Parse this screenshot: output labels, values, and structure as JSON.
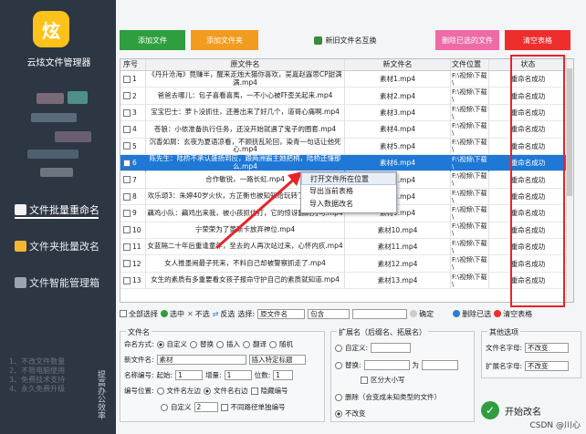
{
  "sidebar": {
    "app_name": "云炫文件管理器",
    "logo_text": "炫",
    "nav": [
      {
        "label": "文件批量重命名"
      },
      {
        "label": "文件夹批量改名"
      },
      {
        "label": "文件智能管理箱"
      }
    ],
    "features": [
      "1、不改文件数量",
      "2、不限电脑使用",
      "3、免费技术支持",
      "4、永久免费升级"
    ],
    "slogan": "提高办公效率"
  },
  "toolbar": {
    "add_file": "添加文件",
    "add_folder": "添加文件夹",
    "swap_names": "新旧文件名互换",
    "delete_selected": "删除已选的文件",
    "clear_table": "清空表格"
  },
  "table": {
    "headers": [
      "序号",
      "原文件名",
      "新文件名",
      "文件位置",
      "状态"
    ],
    "rows": [
      {
        "idx": "1",
        "orig": "《丹升沧海》竟赚半，醒来走烛大猫你喜欢，吴嘉赵露思CP甜满满.mp4",
        "new": "素材1.mp4",
        "loc": "F:\\视频\\下载\\",
        "status": "重命名成功"
      },
      {
        "idx": "2",
        "orig": "爸爸去哪儿：包子喜看喜夷，一不小心被吓歪关起来.mp4",
        "new": "素材2.mp4",
        "loc": "F:\\视频\\下载\\",
        "status": "重命名成功"
      },
      {
        "idx": "3",
        "orig": "宝宝巴士：萝卜没抓住，还善出来了好几个，道哥心痛啊.mp4",
        "new": "素材3.mp4",
        "loc": "F:\\视频\\下载\\",
        "status": "重命名成功"
      },
      {
        "idx": "4",
        "orig": "苍狼：小侬准备执行任务，还没开始就遇了鬼子的圈套.mp4",
        "new": "素材4.mp4",
        "loc": "F:\\视频\\下载\\",
        "status": "重命名成功"
      },
      {
        "idx": "5",
        "orig": "沉香如屑：玄夜为夏语凉看，不顾抚乱轮回，染青一句话让他死心.mp4",
        "new": "素材5.mp4",
        "loc": "F:\\视频\\下载\\",
        "status": "重命名成功"
      },
      {
        "idx": "6",
        "orig": "陈先生：陆桥不承认盛扬到应，跟两洲霸主她把柄，陆桥还懂那么.mp4",
        "new": "素材6.mp4",
        "loc": "F:\\视频\\下载\\",
        "status": "重命名成功"
      },
      {
        "idx": "7",
        "orig": "合作敏锐，一路长虹.mp4",
        "new": "素材7.mp4",
        "loc": "F:\\视频\\下载\\",
        "status": "重命名成功"
      },
      {
        "idx": "8",
        "orig": "欢乐颂3：朱婷40岁火伙，方芷衡也被知知给玩转了被分手.mp4",
        "new": "素材8.mp4",
        "loc": "F:\\视频\\下载\\",
        "status": "重命名成功"
      },
      {
        "idx": "9",
        "orig": "藕鸡小队：藕鸡出来我，被小孩抓住打，它的惊讶翻刷为马.mp4",
        "new": "素材9.mp4",
        "loc": "F:\\视频\\下载\\",
        "status": "重命名成功"
      },
      {
        "idx": "10",
        "orig": "宁荣荣为了黄斯卡放弃神位.mp4",
        "new": "素材10.mp4",
        "loc": "F:\\视频\\下载\\",
        "status": "重命名成功"
      },
      {
        "idx": "11",
        "orig": "女蓝隔二十年后重逢童年，至去的人再次站过来，心怀内疚.mp4",
        "new": "素材11.mp4",
        "loc": "F:\\视频\\下载\\",
        "status": "重命名成功"
      },
      {
        "idx": "12",
        "orig": "女人推墨闹最子死来，不料自己却被警察抓走了.mp4",
        "new": "素材12.mp4",
        "loc": "F:\\视频\\下载\\",
        "status": "重命名成功"
      },
      {
        "idx": "13",
        "orig": "女生的素质有多重要看女孩子报命守护自己的素质就知道.mp4",
        "new": "素材13.mp4",
        "loc": "F:\\视频\\下载\\",
        "status": "重命名成功"
      }
    ]
  },
  "context_menu": [
    "打开文件所在位置",
    "导出当前表格",
    "导入数据改名"
  ],
  "filters": {
    "select_all": "全部选择",
    "select": "选中",
    "deselect": "不选",
    "invert": "反选",
    "select_label": "选择:",
    "field": "原文件名",
    "mode": "包含",
    "confirm": "确定",
    "delete_selected": "删除已选",
    "clear_table": "清空表格"
  },
  "filename_group": {
    "title": "文件名",
    "mode_label": "命名方式:",
    "modes": [
      "自定义",
      "替换",
      "插入",
      "翻译",
      "随机"
    ],
    "new_name_label": "新文件名:",
    "new_name_value": "素材",
    "insert_label": "插入特定标题",
    "num_label": "名称编号:",
    "start_label": "起始:",
    "start_value": "1",
    "step_label": "增量:",
    "step_value": "1",
    "digits_label": "位数:",
    "digits_value": "1",
    "pos_label": "编号位置:",
    "pos_left": "文件名左边",
    "pos_right": "文件名右边",
    "hide_num": "隐藏编号",
    "custom_label": "自定义",
    "custom_value": "2",
    "diff_path": "不同路径单独编号"
  },
  "ext_group": {
    "title": "扩展名（后缀名、拓展名）",
    "custom": "自定义:",
    "replace": "替换:",
    "to": "为",
    "case": "区分大小写",
    "remove": "删除（会变成未知类型的文件）",
    "nochange": "不改变"
  },
  "other_group": {
    "title": "其他选项",
    "font_label": "文件名字母:",
    "font_value": "不改变",
    "ext_font_label": "扩展名字母:",
    "ext_font_value": "不改变"
  },
  "start_button": "开始改名",
  "watermark": "CSDN @川心",
  "colors": {
    "sidebar": "#2d3643",
    "accent_green": "#2e9e3f",
    "accent_orange": "#f29c1f",
    "accent_pink": "#ee6ba7",
    "accent_red": "#ee2d2d",
    "selection_blue": "#1f78d6"
  }
}
